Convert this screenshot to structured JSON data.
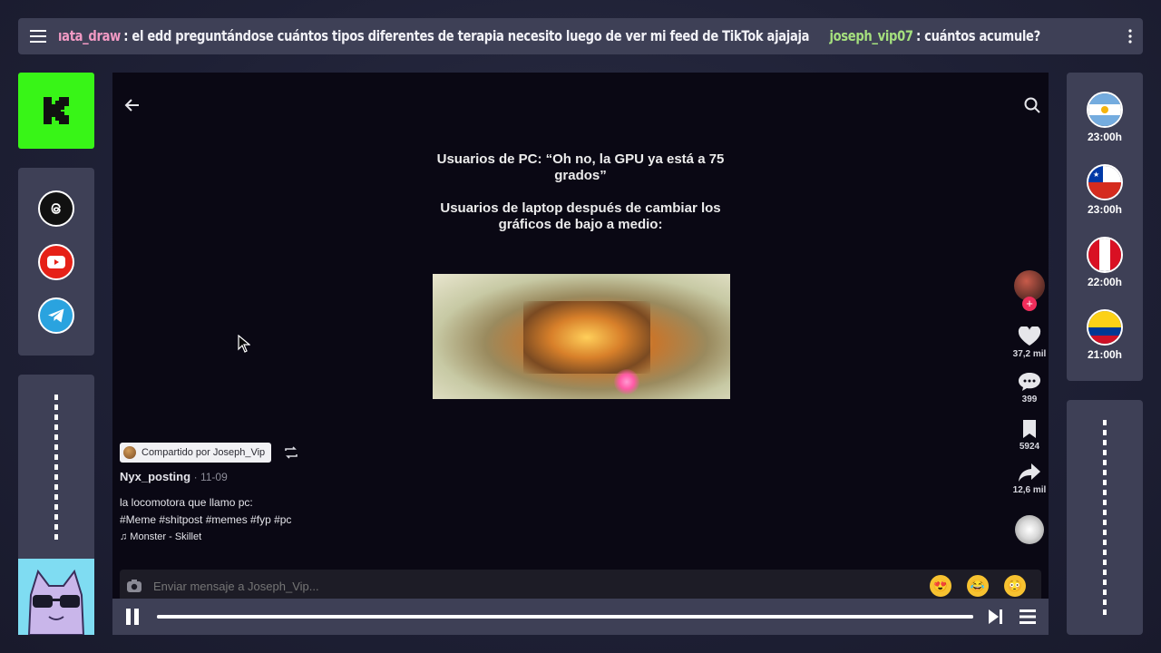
{
  "chat": {
    "msg1_user": "ıata_draw",
    "msg1_text": ": el edd preguntándose cuántos tipos diferentes de terapia necesito luego de ver mi feed de TikTok ajajaja",
    "msg2_user": "joseph_vip07",
    "msg2_text": ": cuántos acumule?"
  },
  "schedule": [
    {
      "country": "Argentina",
      "time": "23:00h"
    },
    {
      "country": "Chile",
      "time": "23:00h"
    },
    {
      "country": "Peru",
      "time": "22:00h"
    },
    {
      "country": "Colombia",
      "time": "21:00h"
    }
  ],
  "meme": {
    "line1": "Usuarios de PC: “Oh no, la GPU ya está a 75 grados”",
    "line2": "Usuarios de laptop después de cambiar los gráficos de bajo a medio:"
  },
  "post": {
    "shared_by": "Compartido por Joseph_Vip",
    "author": "Nyx_posting",
    "date": "· 11-09",
    "caption": "la locomotora que llamo pc:",
    "hashtags": "#Meme #shitpost #memes #fyp #pc",
    "music": "♫ Monster - Skillet"
  },
  "actions": {
    "likes": "37,2 mil",
    "comments": "399",
    "saves": "5924",
    "shares": "12,6 mil"
  },
  "message_input": {
    "placeholder": "Enviar mensaje a Joseph_Vip..."
  },
  "player": {
    "progress": 1.0
  },
  "colors": {
    "kick_green": "#38f517",
    "panel": "#3e4056",
    "user1": "#f29ac4",
    "user2": "#a5e07e"
  }
}
